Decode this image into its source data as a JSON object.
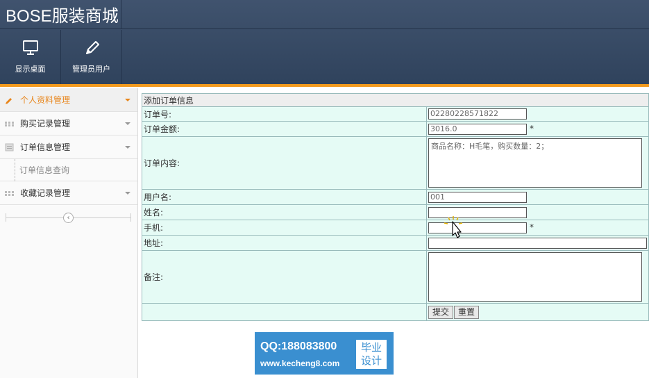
{
  "app": {
    "title": "BOSE服装商城"
  },
  "toolbar": {
    "buttons": [
      {
        "label": "显示桌面",
        "icon": "monitor-icon"
      },
      {
        "label": "管理员用户",
        "icon": "pencil-icon"
      }
    ]
  },
  "sidebar": {
    "items": [
      {
        "label": "个人资料管理",
        "icon": "pencil-icon",
        "active": true
      },
      {
        "label": "购买记录管理",
        "icon": "grid-icon"
      },
      {
        "label": "订单信息管理",
        "icon": "document-icon"
      },
      {
        "label": "收藏记录管理",
        "icon": "grid-icon"
      }
    ],
    "submenu": {
      "label": "订单信息查询"
    }
  },
  "form": {
    "caption": "添加订单信息",
    "fields": {
      "order_no": {
        "label": "订单号:",
        "value": "02280228571822"
      },
      "amount": {
        "label": "订单金额:",
        "value": "3016.0",
        "required": "*"
      },
      "content": {
        "label": "订单内容:",
        "value": "商品名称：H毛笔，购买数量：2；"
      },
      "username": {
        "label": "用户名:",
        "value": "001"
      },
      "name": {
        "label": "姓名:",
        "value": ""
      },
      "phone": {
        "label": "手机:",
        "value": "",
        "required": "*"
      },
      "address": {
        "label": "地址:",
        "value": ""
      },
      "remark": {
        "label": "备注:",
        "value": ""
      }
    },
    "submit_label": "提交",
    "reset_label": "重置"
  },
  "watermark": {
    "line1": "QQ:188083800",
    "line2": "www.kecheng8.com",
    "tag_line1": "毕业",
    "tag_line2": "设计"
  },
  "colors": {
    "header": "#34475f",
    "accent": "#f39a1d",
    "form_bg": "#e5fbf5",
    "watermark": "#3a8fd0"
  }
}
